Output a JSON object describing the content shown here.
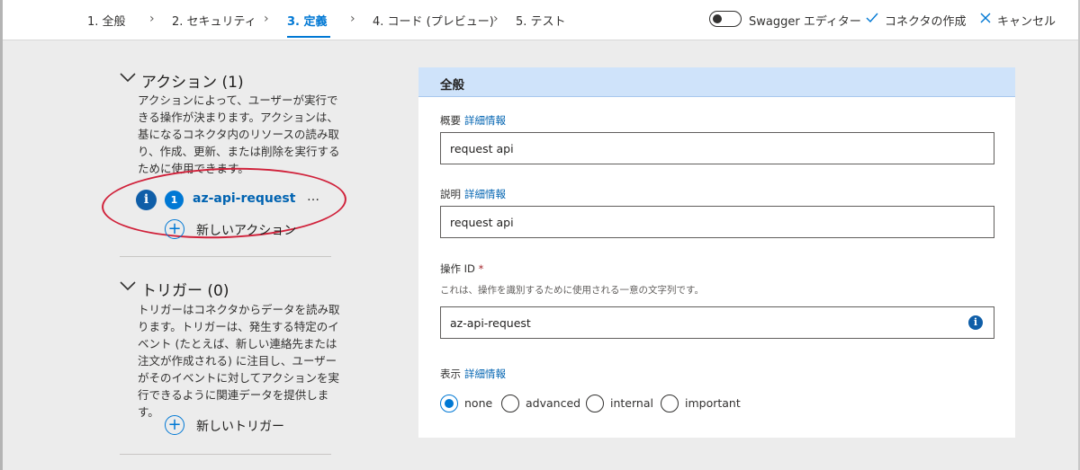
{
  "wizard": {
    "steps": [
      {
        "label": "1. 全般"
      },
      {
        "label": "2. セキュリティ"
      },
      {
        "label": "3. 定義"
      },
      {
        "label": "4. コード (プレビュー)"
      },
      {
        "label": "5. テスト"
      }
    ],
    "active_step": 2,
    "swagger_toggle": {
      "label": "Swagger エディター",
      "on": false
    },
    "create_label": "コネクタの作成",
    "cancel_label": "キャンセル"
  },
  "actions_section": {
    "title": "アクション (1)",
    "description": "アクションによって、ユーザーが実行できる操作が決まります。アクションは、基になるコネクタ内のリソースの読み取り、作成、更新、または削除を実行するために使用できます。",
    "items": [
      {
        "badge": "1",
        "name": "az-api-request",
        "more": "…"
      }
    ],
    "add_label": "新しいアクション"
  },
  "triggers_section": {
    "title": "トリガー (0)",
    "description": "トリガーはコネクタからデータを読み取ります。トリガーは、発生する特定のイベント (たとえば、新しい連絡先または注文が作成される) に注目し、ユーザーがそのイベントに対してアクションを実行できるように関連データを提供します。",
    "add_label": "新しいトリガー"
  },
  "general_panel": {
    "title": "全般",
    "summary": {
      "label": "概要",
      "link": "詳細情報",
      "value": "request api"
    },
    "description": {
      "label": "説明",
      "link": "詳細情報",
      "value": "request api"
    },
    "operation_id": {
      "label": "操作 ID",
      "required": "*",
      "help": "これは、操作を識別するために使用される一意の文字列です。",
      "value": "az-api-request"
    },
    "visibility": {
      "label": "表示",
      "link": "詳細情報",
      "options": [
        "none",
        "advanced",
        "internal",
        "important"
      ],
      "selected": "none"
    }
  },
  "colors": {
    "accent": "#0078d4",
    "annotation": "#d0213a",
    "header_bg": "#cfe3fa"
  }
}
